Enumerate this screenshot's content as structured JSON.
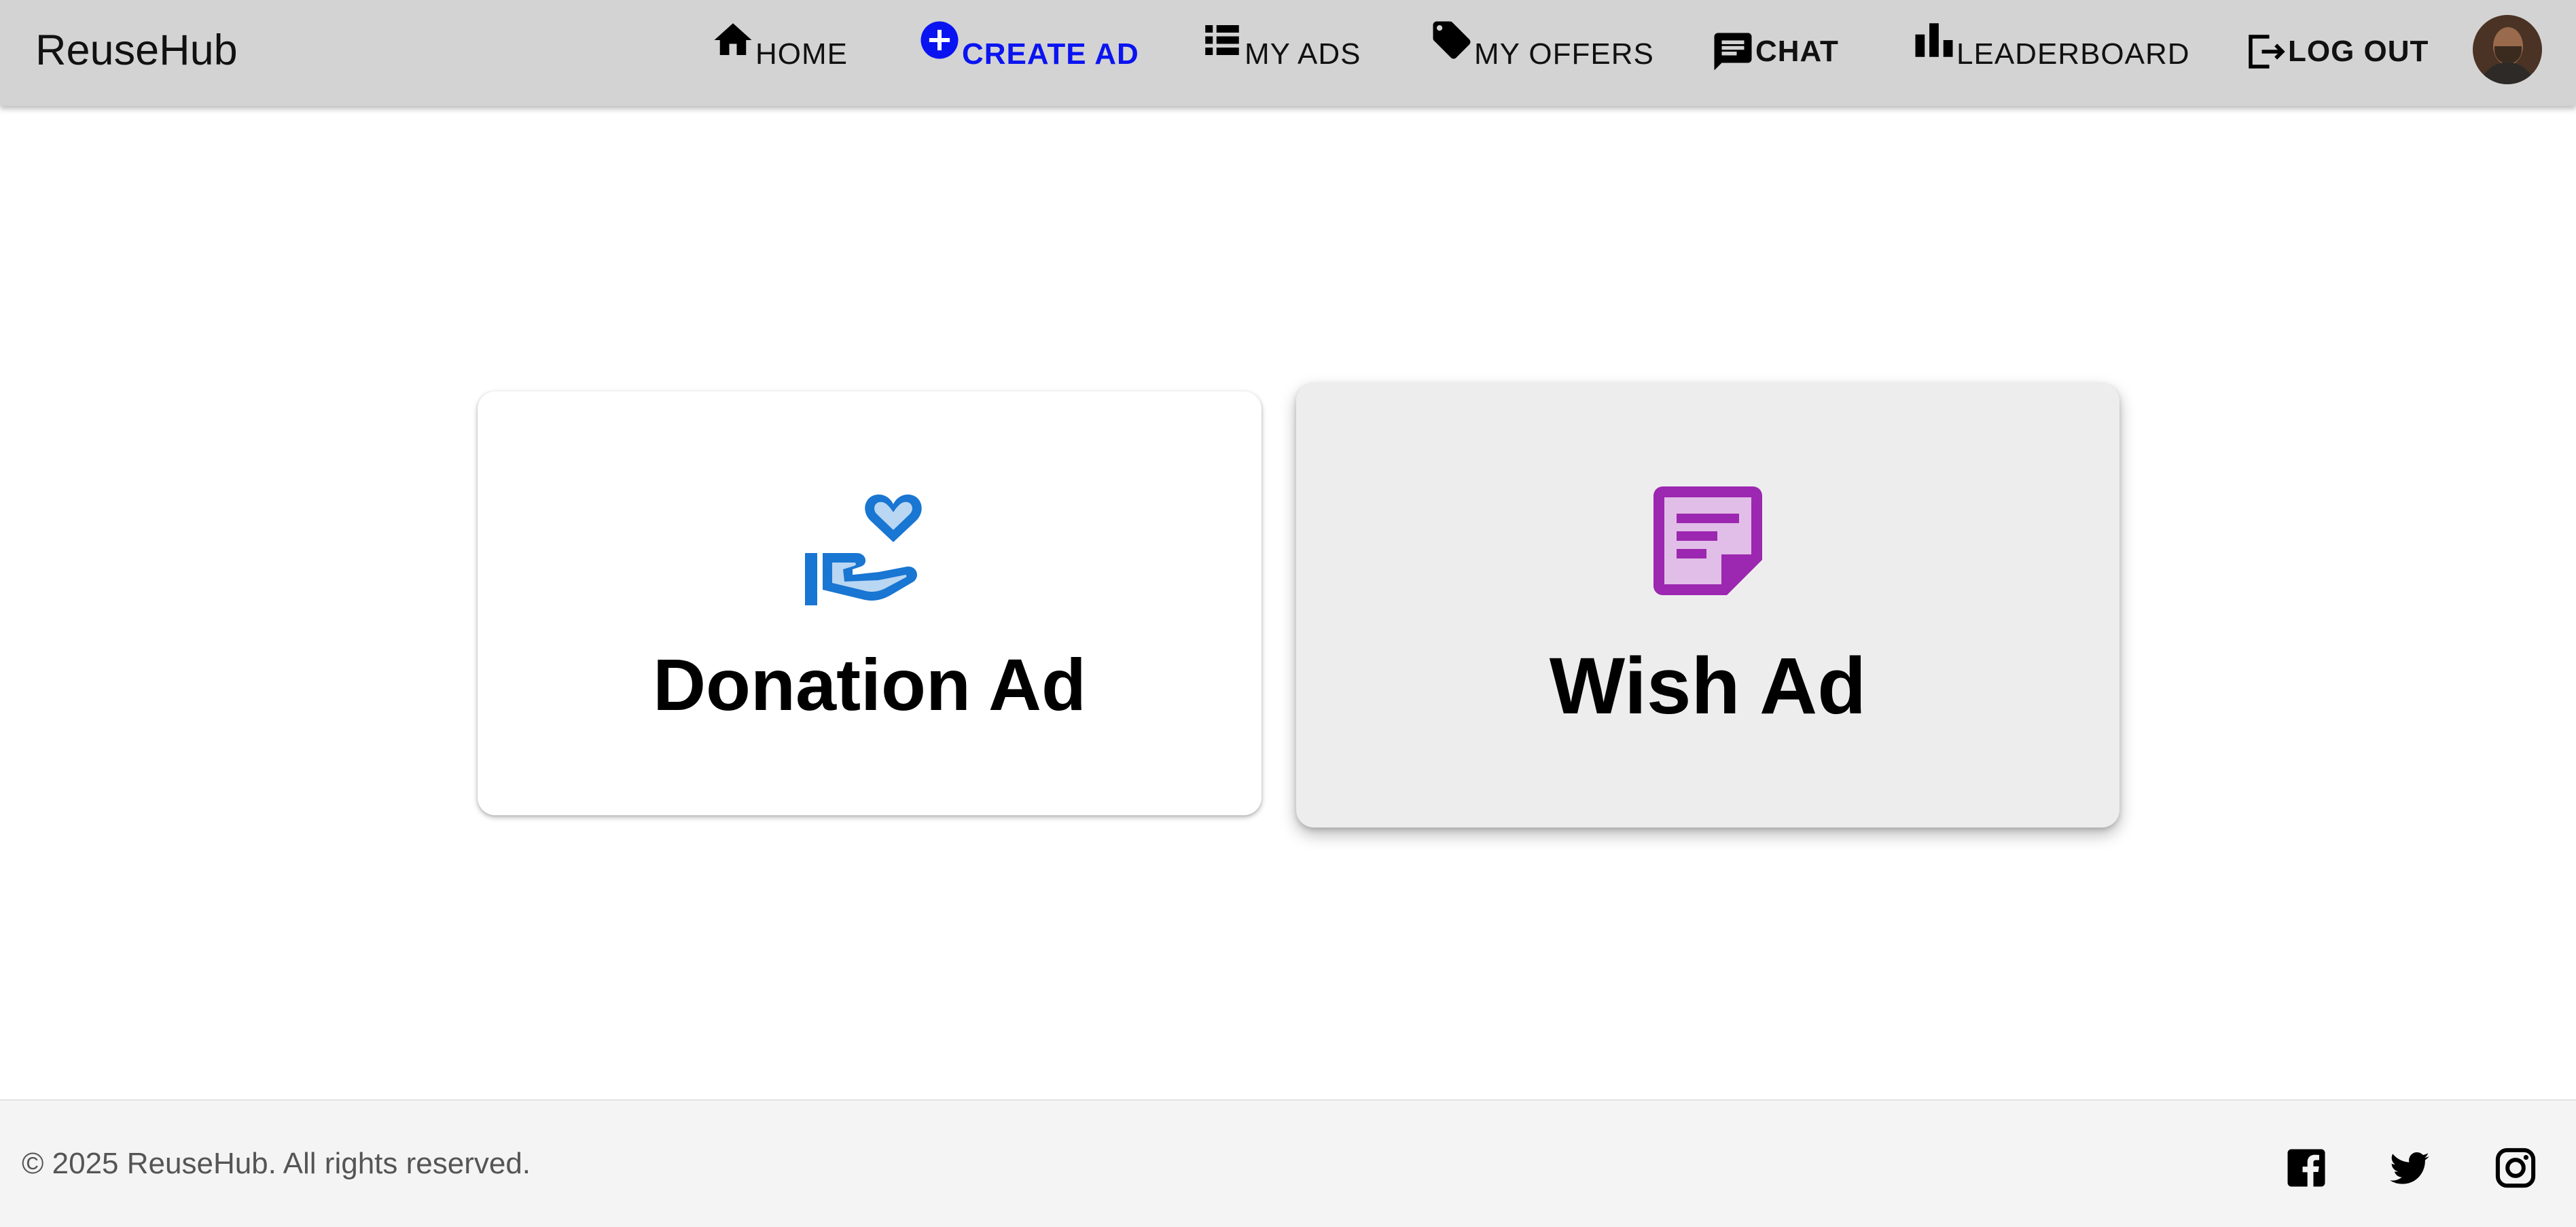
{
  "app": {
    "brand": "ReuseHub"
  },
  "nav": {
    "home": {
      "label": "HOME",
      "icon": "home-icon"
    },
    "create_ad": {
      "label": "CREATE AD",
      "icon": "plus-circle-icon",
      "active": true,
      "active_color": "#0a14f0"
    },
    "my_ads": {
      "label": "MY ADS",
      "icon": "list-icon"
    },
    "my_offers": {
      "label": "MY OFFERS",
      "icon": "tag-icon"
    },
    "chat": {
      "label": "CHAT",
      "icon": "chat-icon"
    },
    "leaderboard": {
      "label": "LEADERBOARD",
      "icon": "bar-chart-icon"
    },
    "logout": {
      "label": "LOG OUT",
      "icon": "logout-icon"
    }
  },
  "user": {
    "avatar": "user-avatar"
  },
  "cards": {
    "donation": {
      "title": "Donation Ad",
      "icon": "hand-heart-icon",
      "icon_color": "#1976d2"
    },
    "wish": {
      "title": "Wish Ad",
      "icon": "sticky-note-icon",
      "icon_color": "#9c27b0"
    }
  },
  "footer": {
    "copyright": "© 2025 ReuseHub. All rights reserved.",
    "social": [
      "facebook-icon",
      "twitter-icon",
      "instagram-icon"
    ]
  },
  "colors": {
    "header_bg": "#d3d3d3",
    "footer_bg": "#f4f4f4",
    "wish_card_bg": "#ededed"
  }
}
